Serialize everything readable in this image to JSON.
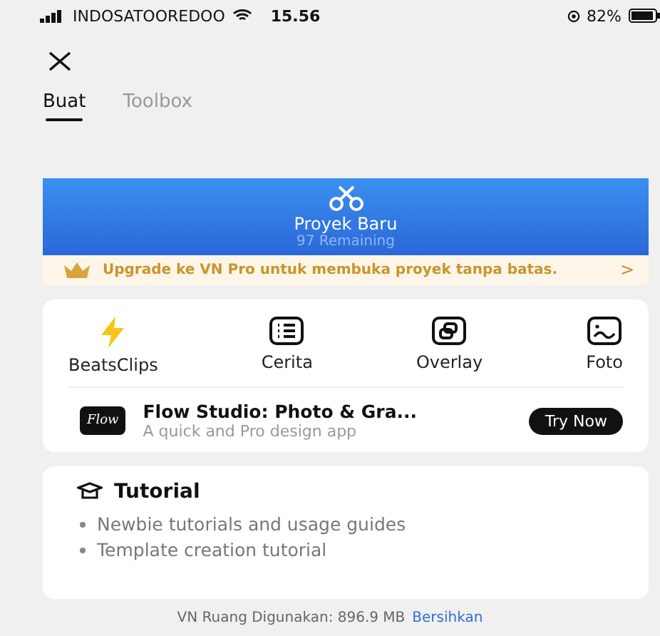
{
  "status_bar": {
    "carrier": "INDOSATOOREDOO",
    "time": "15.56",
    "battery": "82%"
  },
  "tabs": [
    {
      "label": "Buat",
      "selected": true
    },
    {
      "label": "Toolbox",
      "selected": false
    }
  ],
  "new_project": {
    "title": "Proyek Baru",
    "subtitle": "97 Remaining"
  },
  "upgrade_banner": {
    "text": "Upgrade ke VN Pro untuk membuka proyek tanpa batas.",
    "arrow": ">"
  },
  "tools": [
    {
      "kind": "bolt",
      "label": "BeatsClips"
    },
    {
      "kind": "list",
      "label": "Cerita"
    },
    {
      "kind": "overlay",
      "label": "Overlay"
    },
    {
      "kind": "photo",
      "label": "Foto"
    }
  ],
  "promo": {
    "logo": "Flow",
    "title": "Flow Studio: Photo & Gra...",
    "subtitle": "A quick and Pro design app",
    "button": "Try Now"
  },
  "tutorial": {
    "title": "Tutorial",
    "items": [
      "Newbie tutorials and usage guides",
      "Template creation tutorial"
    ]
  },
  "footer": {
    "text": "VN Ruang Digunakan: 896.9 MB",
    "link": "Bersihkan"
  }
}
